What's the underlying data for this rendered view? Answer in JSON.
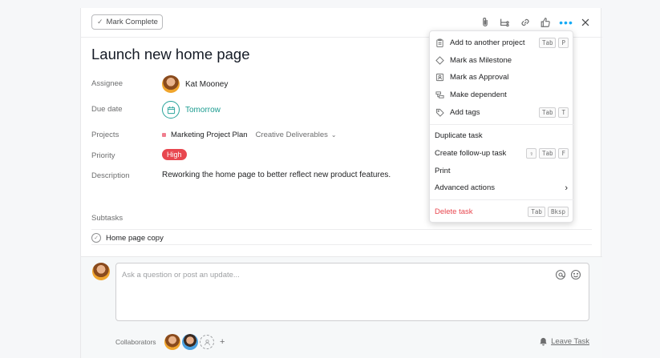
{
  "toolbar": {
    "mark_complete": "Mark Complete",
    "icons": [
      "paperclip-icon",
      "subtask-icon",
      "link-icon",
      "like-icon",
      "more-icon",
      "close-icon"
    ]
  },
  "task": {
    "title": "Launch new home page",
    "assignee_label": "Assignee",
    "assignee_name": "Kat Mooney",
    "due_label": "Due date",
    "due_value": "Tomorrow",
    "projects_label": "Projects",
    "project_name": "Marketing Project Plan",
    "project_section": "Creative Deliverables",
    "priority_label": "Priority",
    "priority_value": "High",
    "description_label": "Description",
    "description": "Reworking the home page to better reflect new product features.",
    "subtasks_label": "Subtasks",
    "subtasks": [
      "Home page copy"
    ]
  },
  "comment": {
    "placeholder": "Ask a question or post an update...",
    "collaborators_label": "Collaborators",
    "leave_task": "Leave Task"
  },
  "menu": {
    "items": [
      {
        "label": "Add to another project",
        "icon": "clipboard-icon",
        "keys": [
          "Tab",
          "P"
        ]
      },
      {
        "label": "Mark as Milestone",
        "icon": "diamond-icon",
        "keys": []
      },
      {
        "label": "Mark as Approval",
        "icon": "approval-icon",
        "keys": []
      },
      {
        "label": "Make dependent",
        "icon": "dependency-icon",
        "keys": []
      },
      {
        "label": "Add tags",
        "icon": "tag-icon",
        "keys": [
          "Tab",
          "T"
        ]
      },
      {
        "label": "Duplicate task",
        "keys": []
      },
      {
        "label": "Create follow-up task",
        "keys": [
          "⇧",
          "Tab",
          "F"
        ]
      },
      {
        "label": "Print",
        "keys": []
      },
      {
        "label": "Advanced actions",
        "keys": []
      },
      {
        "label": "Delete task",
        "keys": [
          "Tab",
          "Bksp"
        ]
      }
    ]
  },
  "colors": {
    "accent_teal": "#1a9b8f",
    "priority_red": "#e8474f",
    "project_pink": "#f07e8e"
  }
}
